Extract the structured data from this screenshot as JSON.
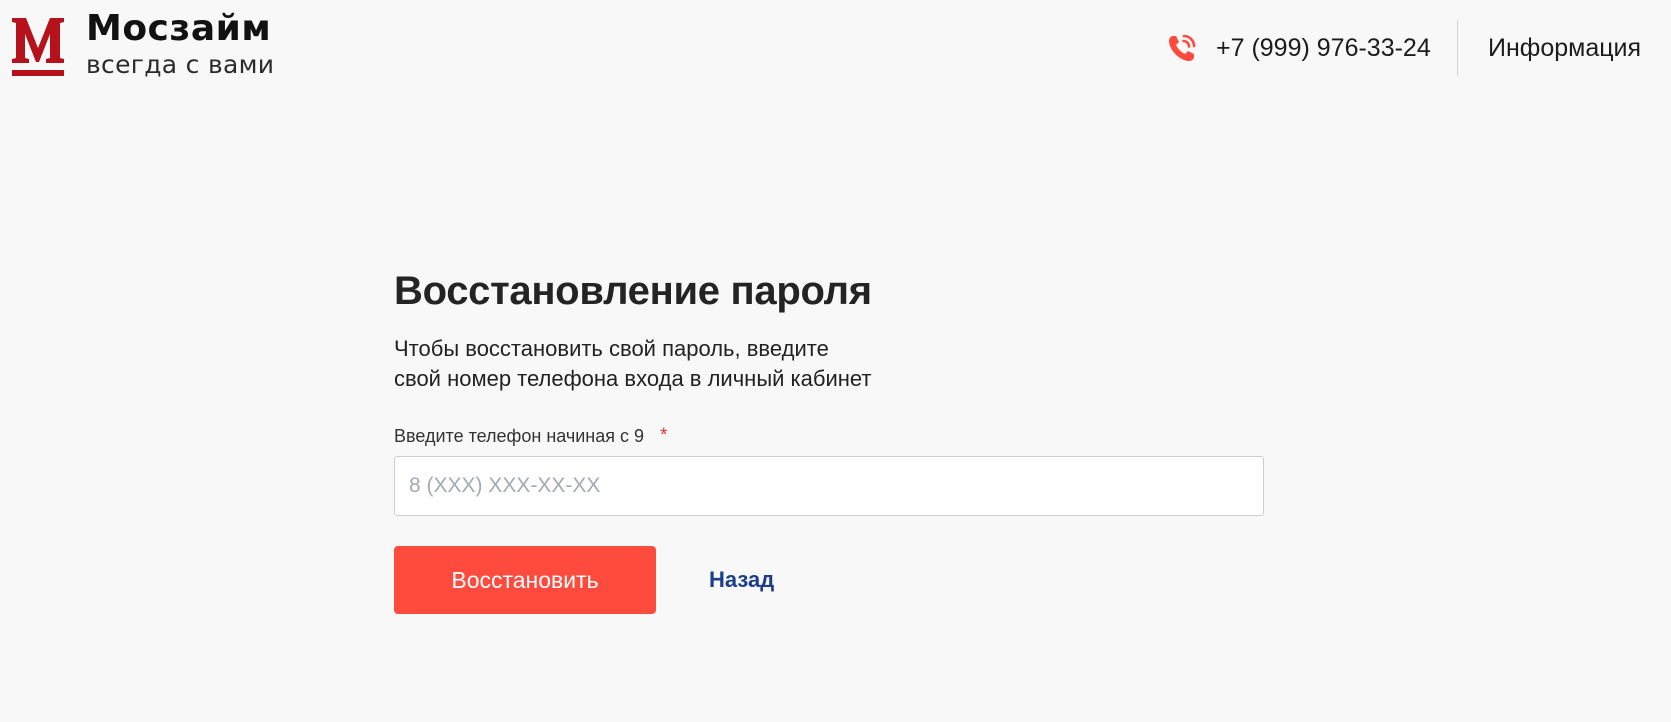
{
  "header": {
    "logo": {
      "letter": "M",
      "name": "Мосзайм",
      "tagline": "всегда с вами",
      "brand_color": "#b5121b"
    },
    "phone": {
      "icon": "phone-call-icon",
      "number": "+7 (999) 976-33-24",
      "icon_color": "#ff4b3e"
    },
    "info_link": "Информация"
  },
  "form": {
    "title": "Восстановление пароля",
    "description_line1": "Чтобы восстановить свой пароль, введите",
    "description_line2": "свой номер телефона входа в личный кабинет",
    "phone_field": {
      "label": "Введите телефон начиная с 9",
      "required_mark": "*",
      "placeholder": "8 (XXX) XXX-XX-XX",
      "value": ""
    },
    "submit_label": "Восстановить",
    "back_label": "Назад"
  },
  "colors": {
    "background": "#f8f8f8",
    "accent": "#ff4b3e",
    "link": "#1c3c8c",
    "required": "#e03535"
  }
}
